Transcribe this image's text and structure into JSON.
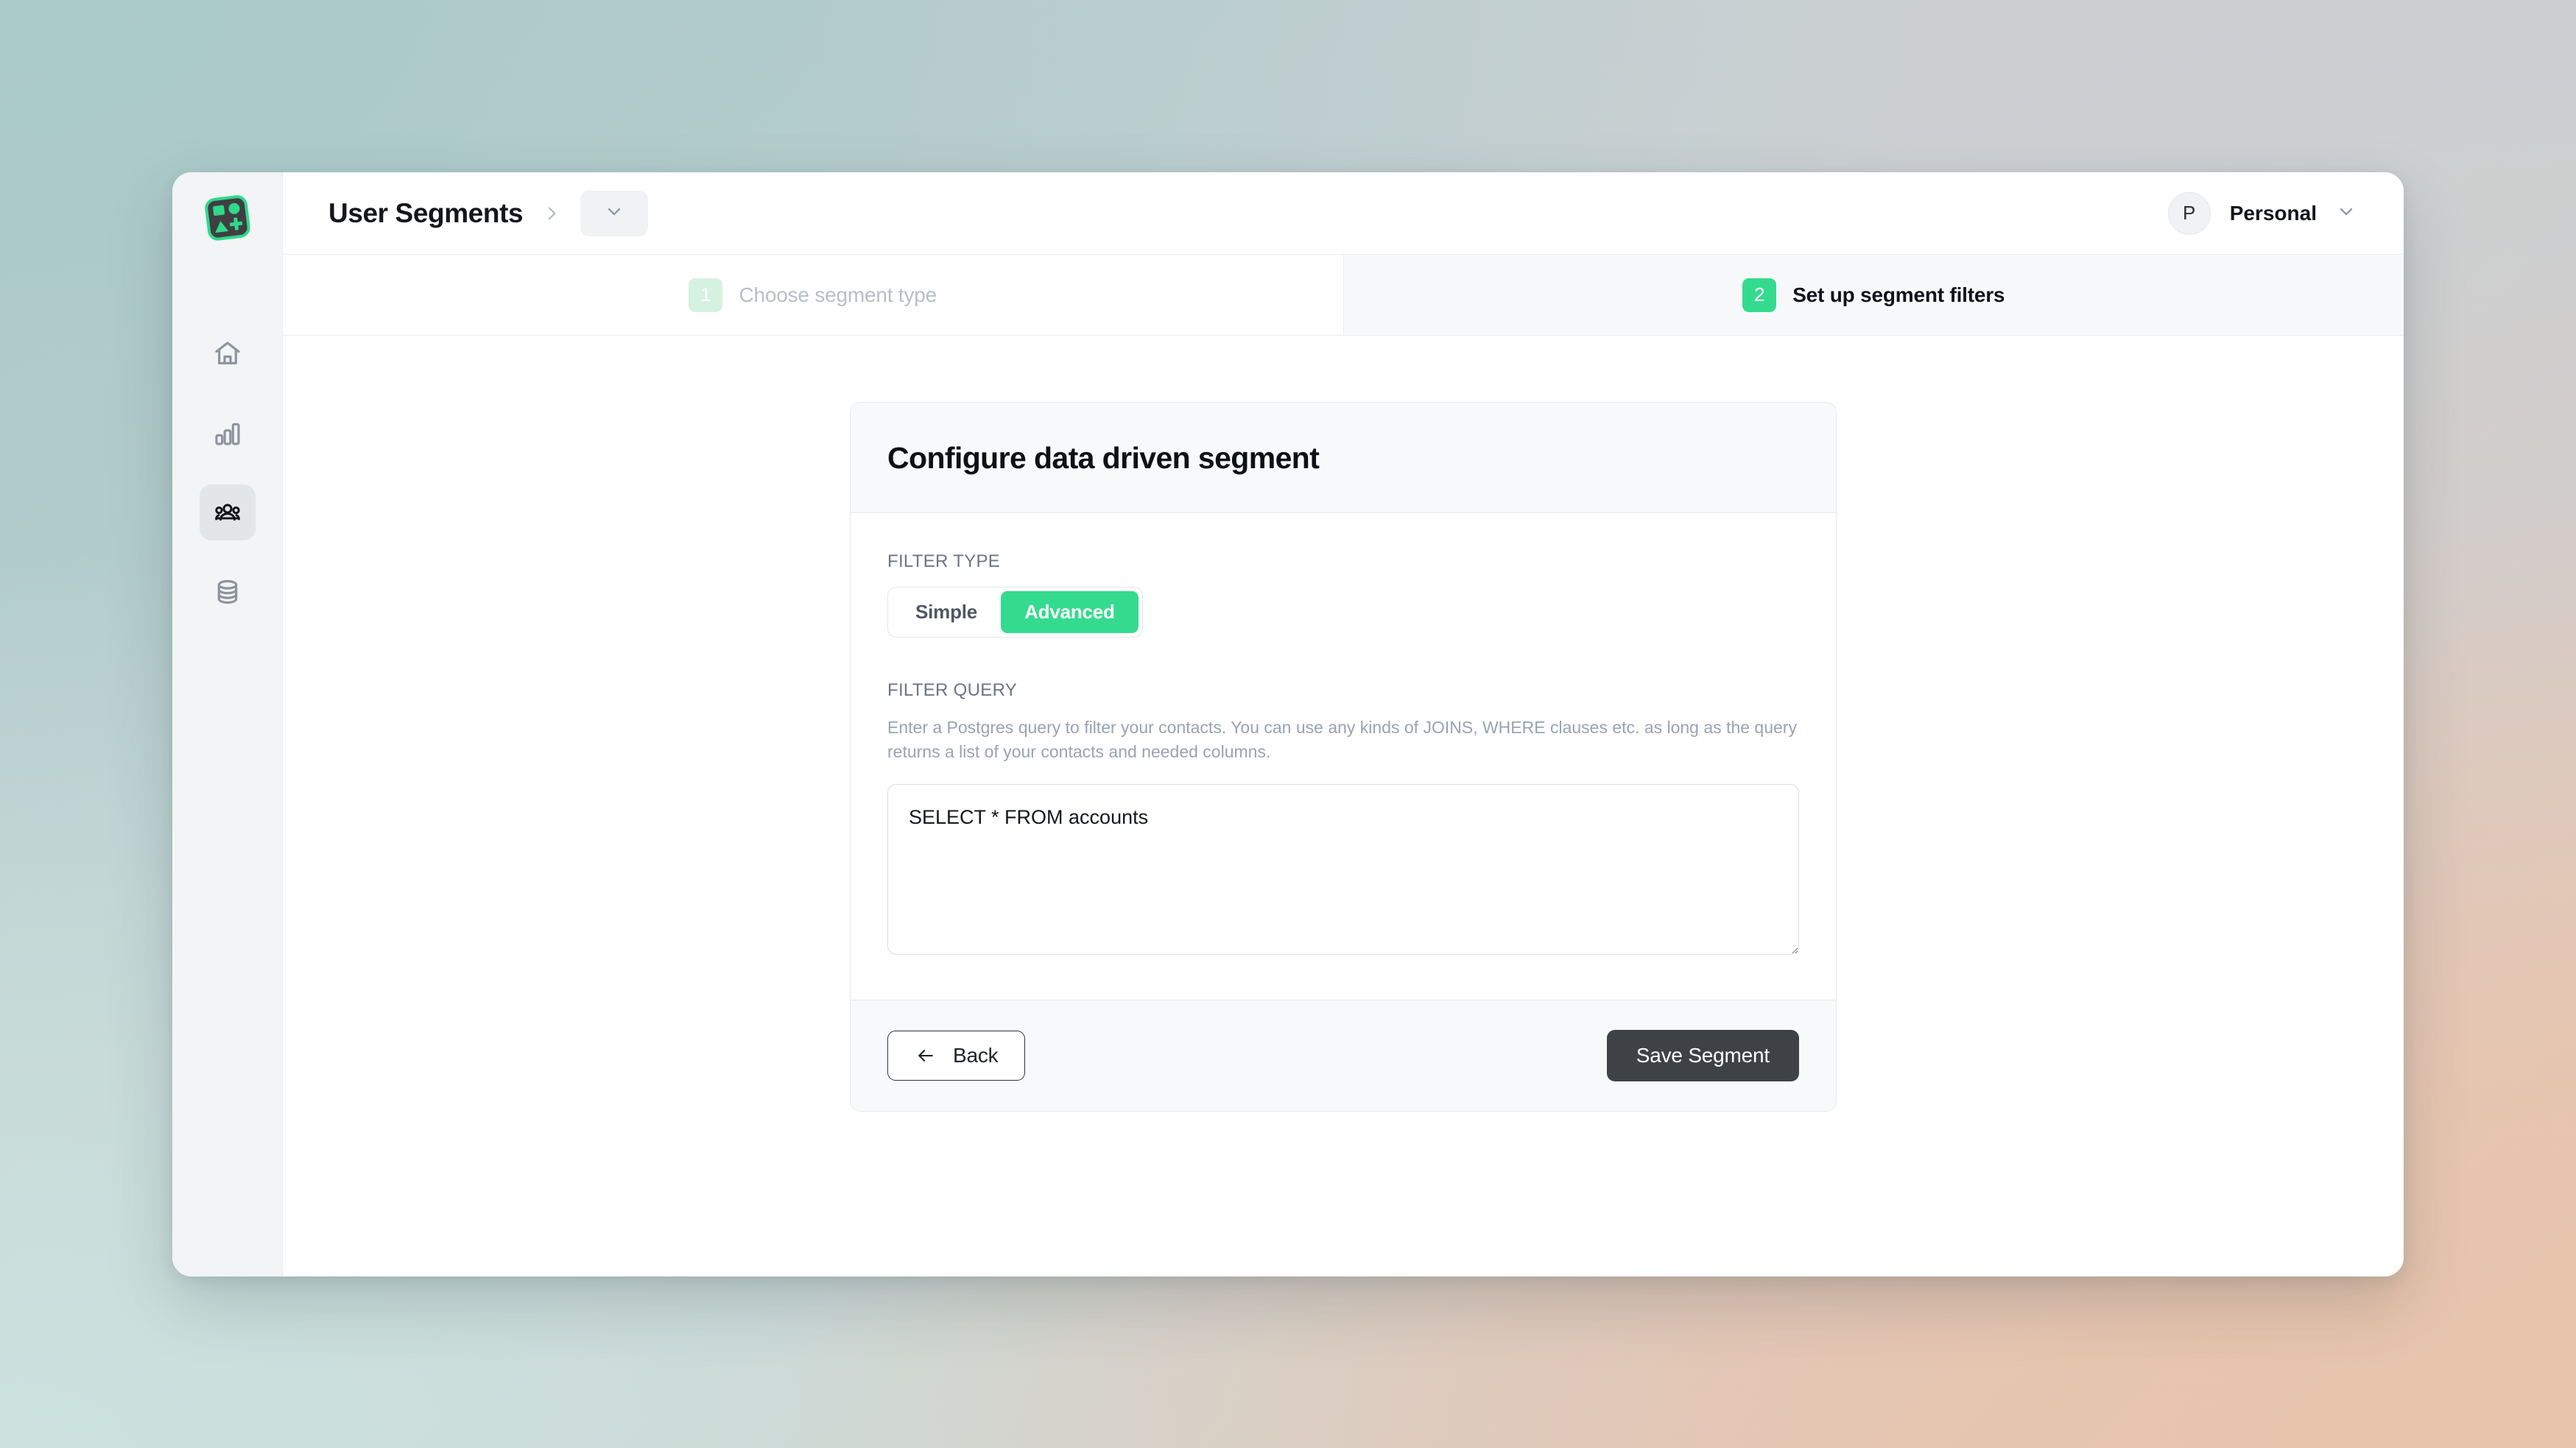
{
  "brand": {
    "logo_icon": "segments-logo-icon",
    "accent_green": "#34db8e",
    "logo_dark": "#3f3f42"
  },
  "sidebar": {
    "items": [
      {
        "icon": "home-icon",
        "name": "home",
        "active": false
      },
      {
        "icon": "bar-chart-icon",
        "name": "analytics",
        "active": false
      },
      {
        "icon": "users-icon",
        "name": "user-segments",
        "active": true
      },
      {
        "icon": "database-icon",
        "name": "data-sources",
        "active": false
      }
    ]
  },
  "topbar": {
    "breadcrumb_title": "User Segments",
    "separator_icon": "chevron-right-icon",
    "dropdown_icon": "chevron-down-icon",
    "org": {
      "avatar_initial": "P",
      "name": "Personal",
      "chevron_icon": "chevron-down-icon"
    }
  },
  "stepper": {
    "steps": [
      {
        "number": "1",
        "label": "Choose segment type",
        "active": false
      },
      {
        "number": "2",
        "label": "Set up segment filters",
        "active": true
      }
    ]
  },
  "card": {
    "title": "Configure data driven segment",
    "filter_type": {
      "label": "FILTER TYPE",
      "options": [
        "Simple",
        "Advanced"
      ],
      "selected": "Advanced"
    },
    "filter_query": {
      "label": "FILTER QUERY",
      "help": "Enter a Postgres query to filter your contacts. You can use any kinds of JOINS, WHERE clauses etc. as long as the query returns a list of your contacts and needed columns.",
      "value": "SELECT * FROM accounts",
      "placeholder": "SELECT * FROM accounts"
    },
    "footer": {
      "back_label": "Back",
      "back_icon": "arrow-left-icon",
      "save_label": "Save Segment"
    }
  }
}
